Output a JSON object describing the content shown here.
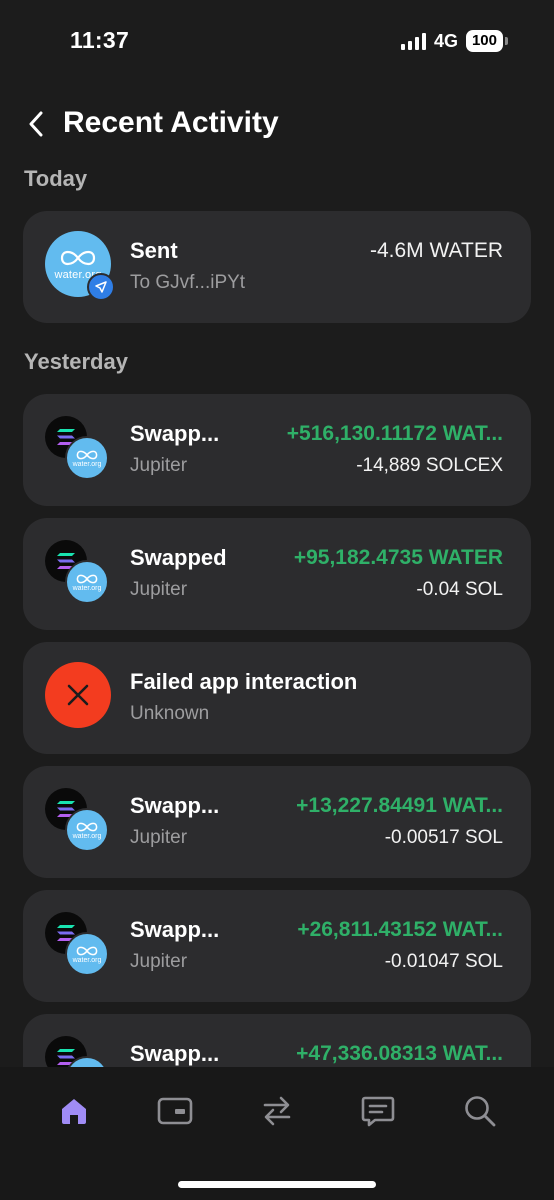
{
  "status_bar": {
    "time": "11:37",
    "network": "4G",
    "battery": "100"
  },
  "header": {
    "title": "Recent Activity"
  },
  "sections": [
    {
      "label": "Today",
      "items": [
        {
          "title": "Sent",
          "subtitle": "To GJvf...iPYt",
          "amount": "-4.6M WATER",
          "amount_sub": ""
        }
      ]
    },
    {
      "label": "Yesterday",
      "items": [
        {
          "title": "Swapp...",
          "subtitle": "Jupiter",
          "amount": "+516,130.11172 WAT...",
          "amount_sub": "-14,889 SOLCEX"
        },
        {
          "title": "Swapped",
          "subtitle": "Jupiter",
          "amount": "+95,182.4735 WATER",
          "amount_sub": "-0.04 SOL"
        },
        {
          "title": "Failed app interaction",
          "subtitle": "Unknown",
          "amount": "",
          "amount_sub": ""
        },
        {
          "title": "Swapp...",
          "subtitle": "Jupiter",
          "amount": "+13,227.84491 WAT...",
          "amount_sub": "-0.00517 SOL"
        },
        {
          "title": "Swapp...",
          "subtitle": "Jupiter",
          "amount": "+26,811.43152 WAT...",
          "amount_sub": "-0.01047 SOL"
        },
        {
          "title": "Swapp...",
          "subtitle": "",
          "amount": "+47,336.08313 WAT...",
          "amount_sub": ""
        }
      ]
    }
  ],
  "logo_text": "water.org",
  "colors": {
    "accent": "#a08cf5",
    "positive": "#2fb068",
    "water": "#62bbef",
    "failed": "#f33c1f",
    "card": "#2c2c2e"
  },
  "tab_bar": {
    "tabs": [
      "home-icon",
      "wallet-card-icon",
      "swap-icon",
      "chat-icon",
      "search-icon"
    ],
    "active": "home-icon"
  }
}
